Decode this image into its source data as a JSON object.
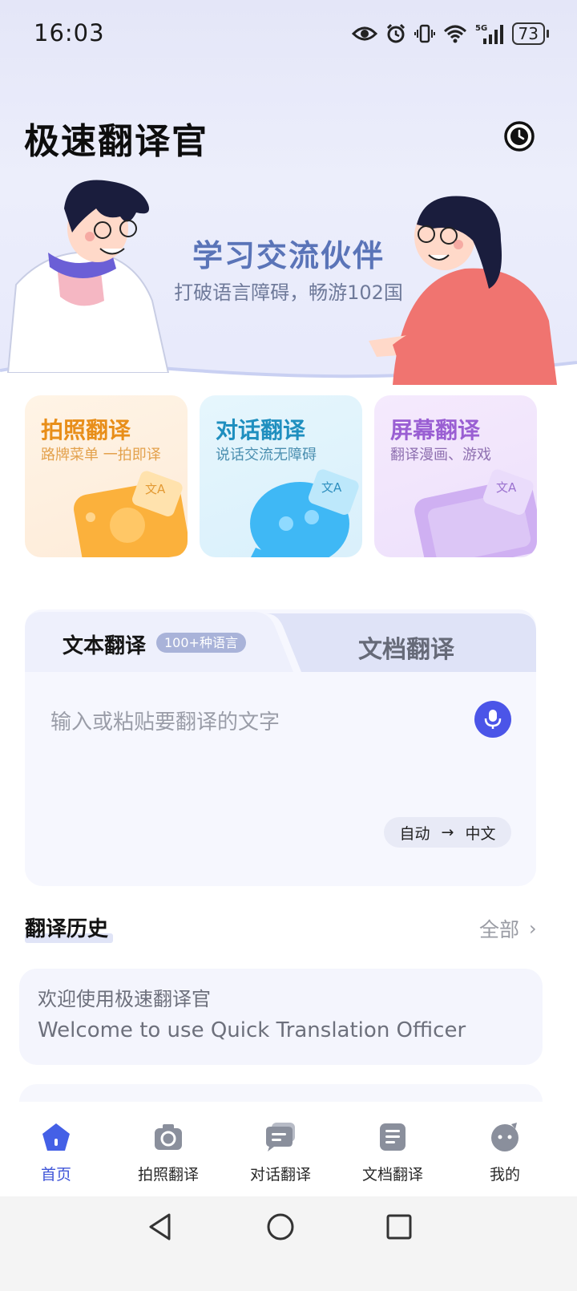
{
  "status": {
    "time": "16:03",
    "battery": "73"
  },
  "header": {
    "title": "极速翻译官"
  },
  "banner": {
    "title": "学习交流伙伴",
    "subtitle": "打破语言障碍，畅游102国"
  },
  "cards": [
    {
      "title": "拍照翻译",
      "subtitle": "路牌菜单 一拍即译"
    },
    {
      "title": "对话翻译",
      "subtitle": "说话交流无障碍"
    },
    {
      "title": "屏幕翻译",
      "subtitle": "翻译漫画、游戏"
    }
  ],
  "translator": {
    "tab_text": "文本翻译",
    "tab_badge": "100+种语言",
    "tab_doc": "文档翻译",
    "placeholder": "输入或粘贴要翻译的文字",
    "source_lang": "自动",
    "arrow": "→",
    "target_lang": "中文"
  },
  "history": {
    "title": "翻译历史",
    "all_label": "全部",
    "chevron": "›",
    "items": [
      {
        "source": "欢迎使用极速翻译官",
        "target": "Welcome to use Quick Translation Officer"
      }
    ]
  },
  "nav": [
    {
      "label": "首页",
      "icon": "home-icon",
      "active": true
    },
    {
      "label": "拍照翻译",
      "icon": "camera-icon"
    },
    {
      "label": "对话翻译",
      "icon": "chat-icon"
    },
    {
      "label": "文档翻译",
      "icon": "document-icon"
    },
    {
      "label": "我的",
      "icon": "profile-icon"
    }
  ],
  "colors": {
    "accent": "#4b55e8",
    "nav_active": "#3f55d8"
  }
}
